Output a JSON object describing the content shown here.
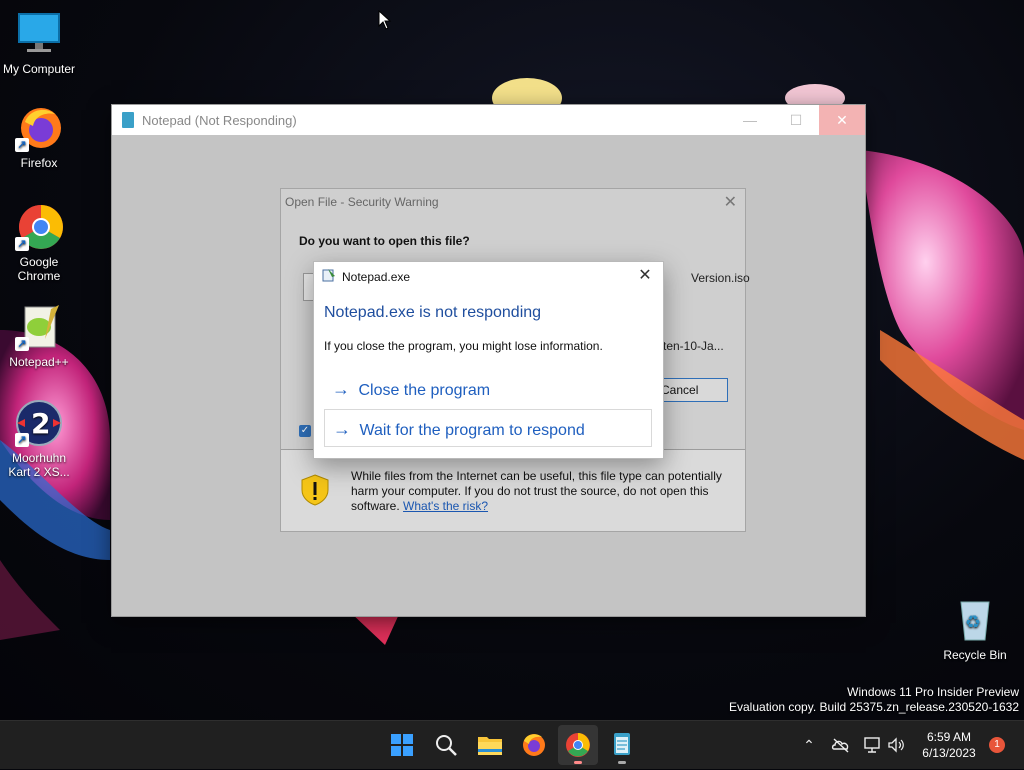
{
  "desktop": {
    "icons": [
      {
        "label": "My Computer"
      },
      {
        "label": "Firefox"
      },
      {
        "label": "Google Chrome"
      },
      {
        "label": "Notepad++"
      },
      {
        "label": "Moorhuhn Kart 2 XS..."
      },
      {
        "label": "Recycle Bin"
      }
    ],
    "watermark_line1": "Windows 11 Pro Insider Preview",
    "watermark_line2": "Evaluation copy. Build 25375.zn_release.230520-1632"
  },
  "notepad_window": {
    "title": "Notepad (Not Responding)",
    "minimize": "—",
    "maximize": "☐",
    "close": "✕"
  },
  "security_dialog": {
    "title": "Open File - Security Warning",
    "close": "✕",
    "question": "Do you want to open this file?",
    "filename_fragment": "Version.iso",
    "publisher_fragment": "ten-10-Ja...",
    "cancel_label": "Cancel",
    "warning_text": "While files from the Internet can be useful, this file type can potentially harm your computer. If you do not trust the source, do not open this software. ",
    "risk_link": "What's the risk?"
  },
  "not_responding_dialog": {
    "title": "Notepad.exe",
    "close": "✕",
    "heading": "Notepad.exe is not responding",
    "info": "If you close the program, you might lose information.",
    "option_close": "Close the program",
    "option_wait": "Wait for the program to respond",
    "arrow": "→"
  },
  "taskbar": {
    "time": "6:59 AM",
    "date": "6/13/2023",
    "notification_count": "1",
    "tray_chevron": "⌃"
  },
  "colors": {
    "accent": "#1f5fbf",
    "taskbar": "#202020",
    "notification": "#e8553a"
  }
}
